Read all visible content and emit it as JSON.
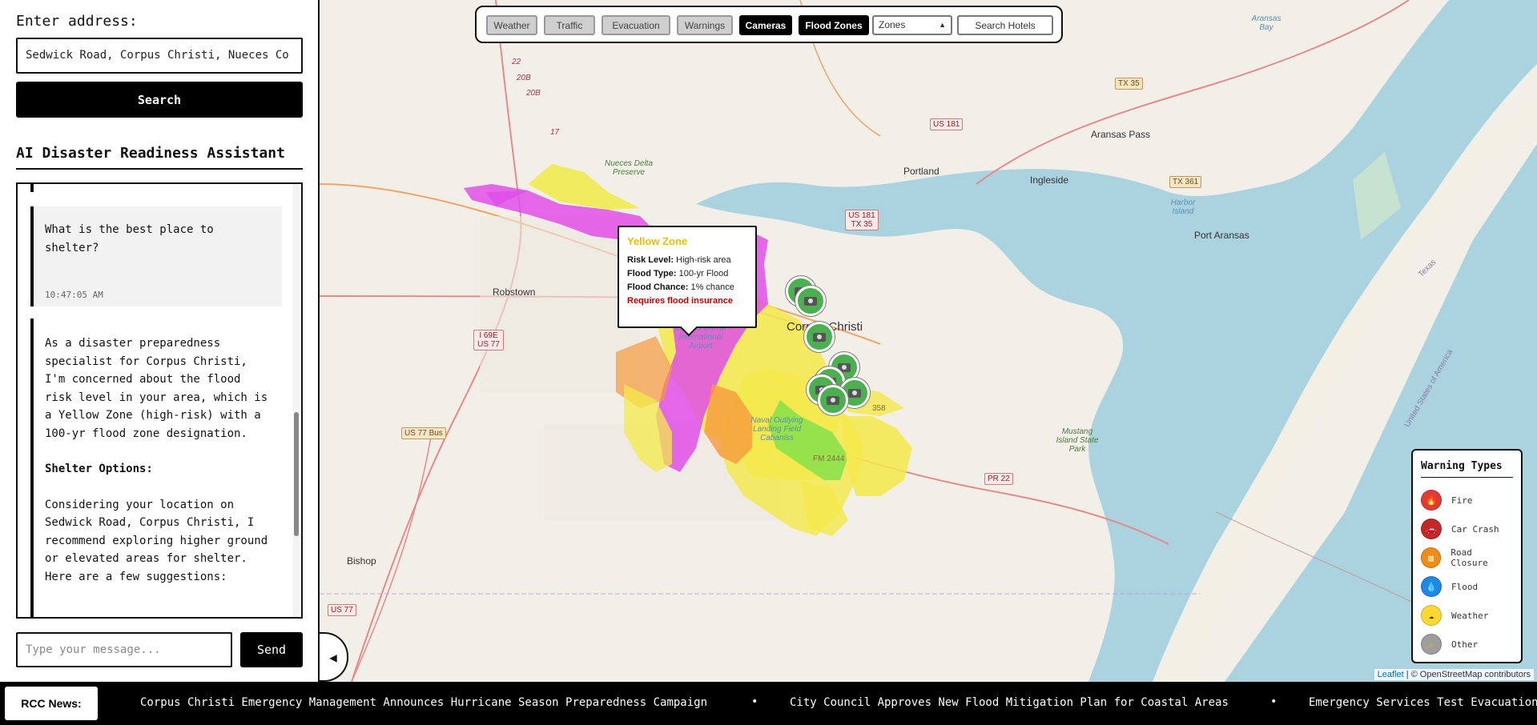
{
  "sidebar": {
    "address_label": "Enter address:",
    "address_value": "Sedwick Road, Corpus Christi, Nueces Co",
    "search_label": "Search",
    "assistant_title": "AI Disaster Readiness Assistant",
    "messages": {
      "user": {
        "text": "What is the best place to shelter?",
        "time": "10:47:05 AM"
      },
      "ai": {
        "p1": "As a disaster preparedness specialist for Corpus Christi, I'm concerned about the flood risk level in your area, which is a Yellow Zone (high-risk) with a 100-yr flood zone designation.",
        "p2": "Shelter Options:",
        "p3": "Considering your location on Sedwick Road, Corpus Christi, I recommend exploring higher ground or elevated areas for shelter. Here are a few suggestions:"
      }
    },
    "message_placeholder": "Type your message...",
    "send_label": "Send",
    "collapse_glyph": "◀"
  },
  "toolbar": {
    "buttons": [
      {
        "label": "Weather",
        "active": false
      },
      {
        "label": "Traffic",
        "active": false
      },
      {
        "label": "Evacuation",
        "active": false
      },
      {
        "label": "Warnings",
        "active": false
      },
      {
        "label": "Cameras",
        "active": true
      },
      {
        "label": "Flood Zones",
        "active": true
      }
    ],
    "zones_select": "Zones",
    "search_hotels": "Search Hotels"
  },
  "popup": {
    "title": "Yellow Zone",
    "risk_label": "Risk Level:",
    "risk_value": "High-risk area",
    "flood_type_label": "Flood Type:",
    "flood_type_value": "100-yr Flood",
    "flood_chance_label": "Flood Chance:",
    "flood_chance_value": "1% chance",
    "requirement": "Requires flood insurance",
    "title_color": "#e8c000",
    "requirement_color": "#c40000"
  },
  "map": {
    "labels": {
      "corpus": "Corpus Christi",
      "portland": "Portland",
      "ingleside": "Ingleside",
      "aransas_pass": "Aransas Pass",
      "port_aransas": "Port Aransas",
      "aransas_bay": "Aransas Bay",
      "robstown": "Robstown",
      "bishop": "Bishop",
      "nueces_delta": "Nueces Delta Preserve",
      "airport": "Corpus Christi International Airport",
      "naval": "Naval Outlying Landing Field Cabaniss",
      "mustang": "Mustang Island State Park",
      "harbor_island": "Harbor Island",
      "texas": "Texas",
      "usa": "United States of America"
    },
    "shields": {
      "us181": "US 181",
      "us181_tx35": "US 181 TX 35",
      "tx35": "TX 35",
      "tx361": "TX 361",
      "i69e": "I 69E US 77",
      "us77bus": "US 77 Bus",
      "us77": "US 77",
      "pr22": "PR 22",
      "fm2444": "FM 2444",
      "n22": "22",
      "n20b_1": "20B",
      "n20b_2": "20B",
      "n17": "17",
      "n358": "358"
    },
    "attribution_leaflet": "Leaflet",
    "attribution_rest": "| © OpenStreetMap contributors"
  },
  "legend": {
    "title": "Warning Types",
    "items": [
      {
        "label": "Fire",
        "color": "#e53935",
        "icon": "fire-icon"
      },
      {
        "label": "Car Crash",
        "color": "#c62828",
        "icon": "car-crash-icon"
      },
      {
        "label": "Road Closure",
        "color": "#ef8c1a",
        "icon": "road-closure-icon"
      },
      {
        "label": "Flood",
        "color": "#1e88e5",
        "icon": "flood-icon"
      },
      {
        "label": "Weather",
        "color": "#fdd835",
        "icon": "weather-icon"
      },
      {
        "label": "Other",
        "color": "#9e9e9e",
        "icon": "warning-icon"
      }
    ]
  },
  "news": {
    "label": "RCC News:",
    "items": [
      "Corpus Christi Emergency Management Announces Hurricane Season Preparedness Campaign",
      "City Council Approves New Flood Mitigation Plan for Coastal Areas",
      "Emergency Services Test Evacuation"
    ],
    "separator": "•"
  }
}
